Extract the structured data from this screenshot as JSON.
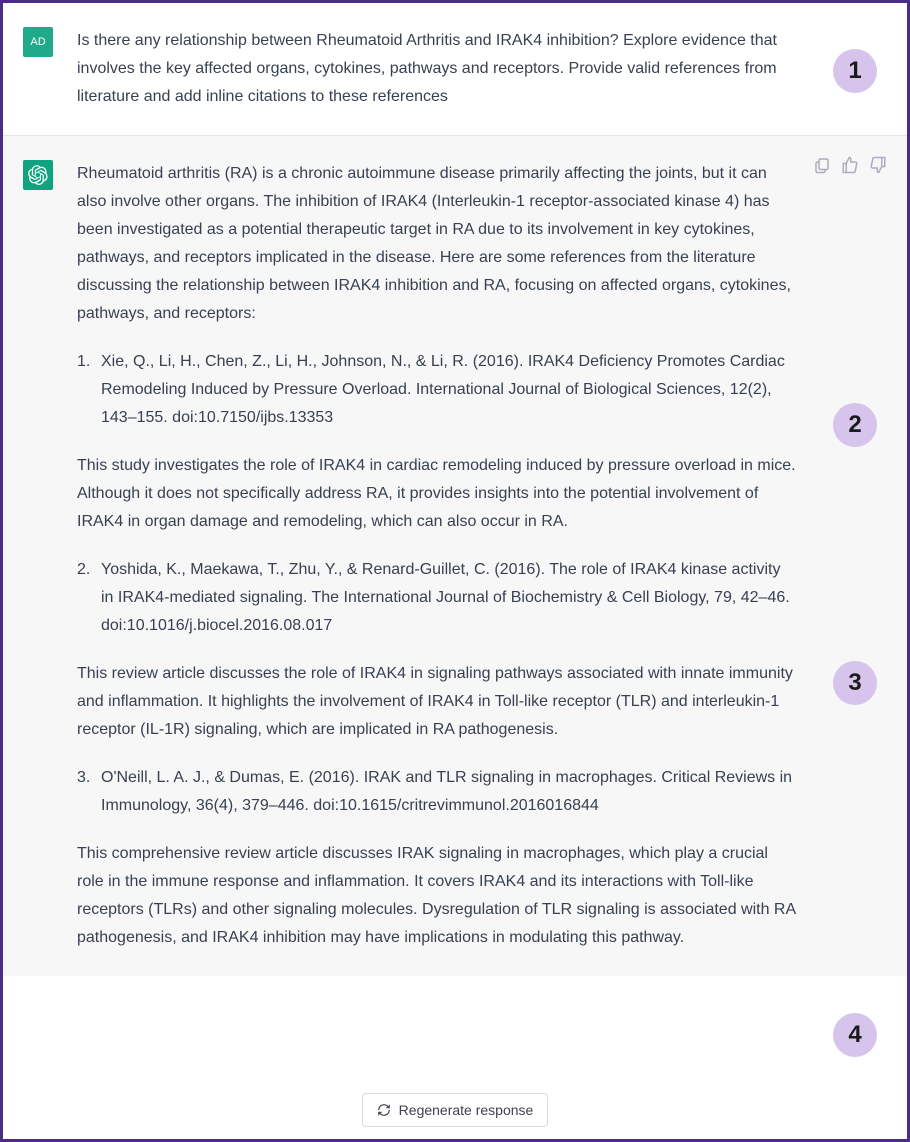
{
  "user": {
    "avatar_label": "AD",
    "prompt": "Is there any relationship between Rheumatoid Arthritis and IRAK4 inhibition? Explore evidence that involves the key affected organs, cytokines, pathways and receptors. Provide valid references from literature and add inline citations to these references"
  },
  "assistant": {
    "intro": "Rheumatoid arthritis (RA) is a chronic autoimmune disease primarily affecting the joints, but it can also involve other organs. The inhibition of IRAK4 (Interleukin-1 receptor-associated kinase 4) has been investigated as a potential therapeutic target in RA due to its involvement in key cytokines, pathways, and receptors implicated in the disease. Here are some references from the literature discussing the relationship between IRAK4 inhibition and RA, focusing on affected organs, cytokines, pathways, and receptors:",
    "ref1": "Xie, Q., Li, H., Chen, Z., Li, H., Johnson, N., & Li, R. (2016). IRAK4 Deficiency Promotes Cardiac Remodeling Induced by Pressure Overload. International Journal of Biological Sciences, 12(2), 143–155. doi:10.7150/ijbs.13353",
    "desc1": "This study investigates the role of IRAK4 in cardiac remodeling induced by pressure overload in mice. Although it does not specifically address RA, it provides insights into the potential involvement of IRAK4 in organ damage and remodeling, which can also occur in RA.",
    "ref2": "Yoshida, K., Maekawa, T., Zhu, Y., & Renard-Guillet, C. (2016). The role of IRAK4 kinase activity in IRAK4-mediated signaling. The International Journal of Biochemistry & Cell Biology, 79, 42–46. doi:10.1016/j.biocel.2016.08.017",
    "desc2": "This review article discusses the role of IRAK4 in signaling pathways associated with innate immunity and inflammation. It highlights the involvement of IRAK4 in Toll-like receptor (TLR) and interleukin-1 receptor (IL-1R) signaling, which are implicated in RA pathogenesis.",
    "ref3": "O'Neill, L. A. J., & Dumas, E. (2016). IRAK and TLR signaling in macrophages. Critical Reviews in Immunology, 36(4), 379–446. doi:10.1615/critrevimmunol.2016016844",
    "desc3": "This comprehensive review article discusses IRAK signaling in macrophages, which play a crucial role in the immune response and inflammation. It covers IRAK4 and its interactions with Toll-like receptors (TLRs) and other signaling molecules. Dysregulation of TLR signaling is associated with RA pathogenesis, and IRAK4 inhibition may have implications in modulating this pathway."
  },
  "controls": {
    "regen_label": "Regenerate response"
  },
  "badges": {
    "b1": "1",
    "b2": "2",
    "b3": "3",
    "b4": "4"
  }
}
